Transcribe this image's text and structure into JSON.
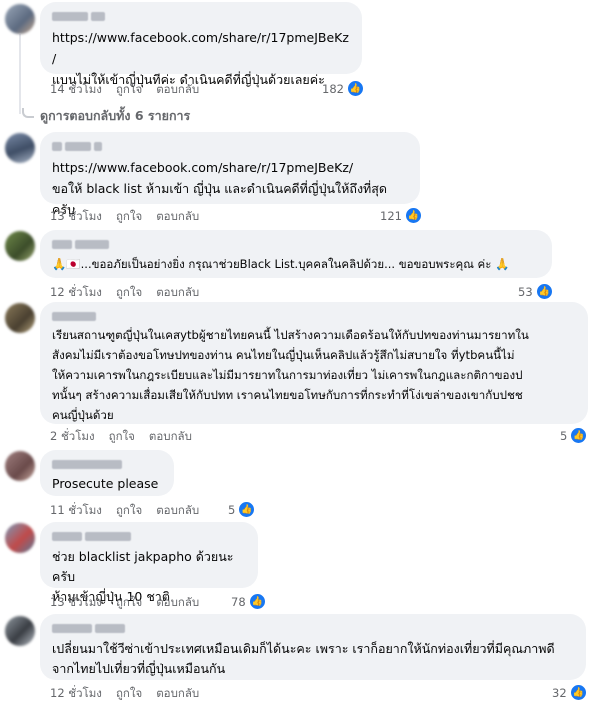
{
  "comments": [
    {
      "lines": [
        "https://www.facebook.com/share/r/17pmeJBeKz/",
        "แบนไม่ให้เข้าญี่ปุ่นทีค่ะ ดำเนินคดีที่ญี่ปุ่นด้วยเลยค่ะ"
      ],
      "time": "14 ชั่วโมง",
      "like_label": "ถูกใจ",
      "reply_label": "ตอบกลับ",
      "reactions": "182"
    },
    {
      "lines": [
        "https://www.facebook.com/share/r/17pmeJBeKz/",
        "ขอให้ black list ห้ามเข้า ญี่ปุ่น และดำเนินคดีที่ญี่ปุ่นให้ถึงที่สุดครับ"
      ],
      "time": "13 ชั่วโมง",
      "like_label": "ถูกใจ",
      "reply_label": "ตอบกลับ",
      "reactions": "121"
    },
    {
      "lines": [
        "🙏🇯🇵...ขออภัยเป็นอย่างยิ่ง กรุณาช่วยBlack List.บุคคลในคลิปด้วย... ขอขอบพระคุณ ค่ะ 🙏"
      ],
      "time": "12 ชั่วโมง",
      "like_label": "ถูกใจ",
      "reply_label": "ตอบกลับ",
      "reactions": "53"
    },
    {
      "lines": [
        "เรียนสถานฑูตญี่ปุ่นในเคสytbผู้ชายไทยคนนี้ ไปสร้างความเดือดร้อนให้กับปทของท่านมารยาทใน",
        "สังคมไม่มีเราต้องขอโทษปทของท่าน คนไทยในญี่ปุ่นเห็นคลิปแล้วรู้สึกไม่สบายใจ ที่ytbคนนี้ไม่",
        "ให้ความเคารพในกฎระเบียบและไม่มีมารยาทในการมาท่องเที่ยว ไม่เคารพในกฎและกติกาของป",
        "ทนั้นๆ สร้างความเสื่อมเสียให้กับปทท เราคนไทยขอโทษกับการที่กระทำที่โง่เขล่าของเขากับปชช",
        "คนญี่ปุ่นด้วย"
      ],
      "time": "2 ชั่วโมง",
      "like_label": "ถูกใจ",
      "reply_label": "ตอบกลับ",
      "reactions": "5"
    },
    {
      "lines": [
        "Prosecute please"
      ],
      "time": "11 ชั่วโมง",
      "like_label": "ถูกใจ",
      "reply_label": "ตอบกลับ",
      "reactions": "5"
    },
    {
      "lines": [
        "ช่วย blacklist jakpapho ด้วยนะครับ",
        "ห้ามเข้าญี่ปุ่น 10 ชาติ"
      ],
      "time": "13 ชั่วโมง",
      "like_label": "ถูกใจ",
      "reply_label": "ตอบกลับ",
      "reactions": "78"
    },
    {
      "lines": [
        "เปลี่ยนมาใช้วีซ่าเข้าประเทศเหมือนเดิมก็ได้นะคะ เพราะ เราก็อยากให้นักท่องเที่ยวที่มีคุณภาพดี",
        "จากไทยไปเที่ยวที่ญี่ปุ่นเหมือนกัน"
      ],
      "time": "12 ชั่วโมง",
      "like_label": "ถูกใจ",
      "reply_label": "ตอบกลับ",
      "reactions": "32"
    }
  ],
  "view_replies_label": "ดูการตอบกลับทั้ง 6 รายการ",
  "icons": {
    "like": "thumbs-up-icon"
  },
  "colors": {
    "like_blue": "#1877f2",
    "bubble_bg": "#f0f2f5",
    "meta_gray": "#65676b"
  }
}
